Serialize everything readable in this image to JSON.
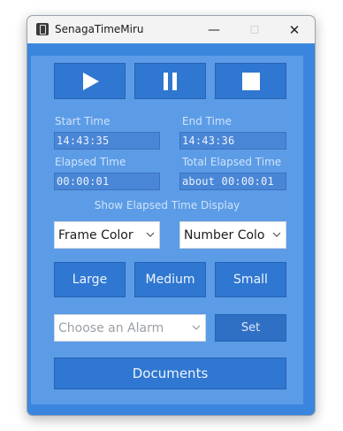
{
  "window": {
    "title": "SenagaTimeMiru"
  },
  "controls": {
    "minimize": "—",
    "maximize": "☐",
    "close": "✕"
  },
  "playback": {
    "play": "play-icon",
    "pause": "pause-icon",
    "stop": "stop-icon"
  },
  "times": {
    "start_label": "Start Time",
    "start_value": "14:43:35",
    "end_label": "End Time",
    "end_value": "14:43:36",
    "elapsed_label": "Elapsed Time",
    "elapsed_value": "00:00:01",
    "total_label": "Total Elapsed Time",
    "total_value": "about 00:00:01"
  },
  "display": {
    "heading": "Show Elapsed Time Display",
    "frame_color": "Frame Color",
    "number_color": "Number Colo"
  },
  "sizes": {
    "large": "Large",
    "medium": "Medium",
    "small": "Small"
  },
  "alarm": {
    "placeholder": "Choose an Alarm",
    "set_label": "Set"
  },
  "documents": {
    "label": "Documents"
  },
  "colors": {
    "window_bg": "#3a86de",
    "panel_bg": "#5c9ce6",
    "button_bg": "#2f77d0",
    "field_bg": "#4a86d6",
    "label_text": "#cfe2fb"
  }
}
